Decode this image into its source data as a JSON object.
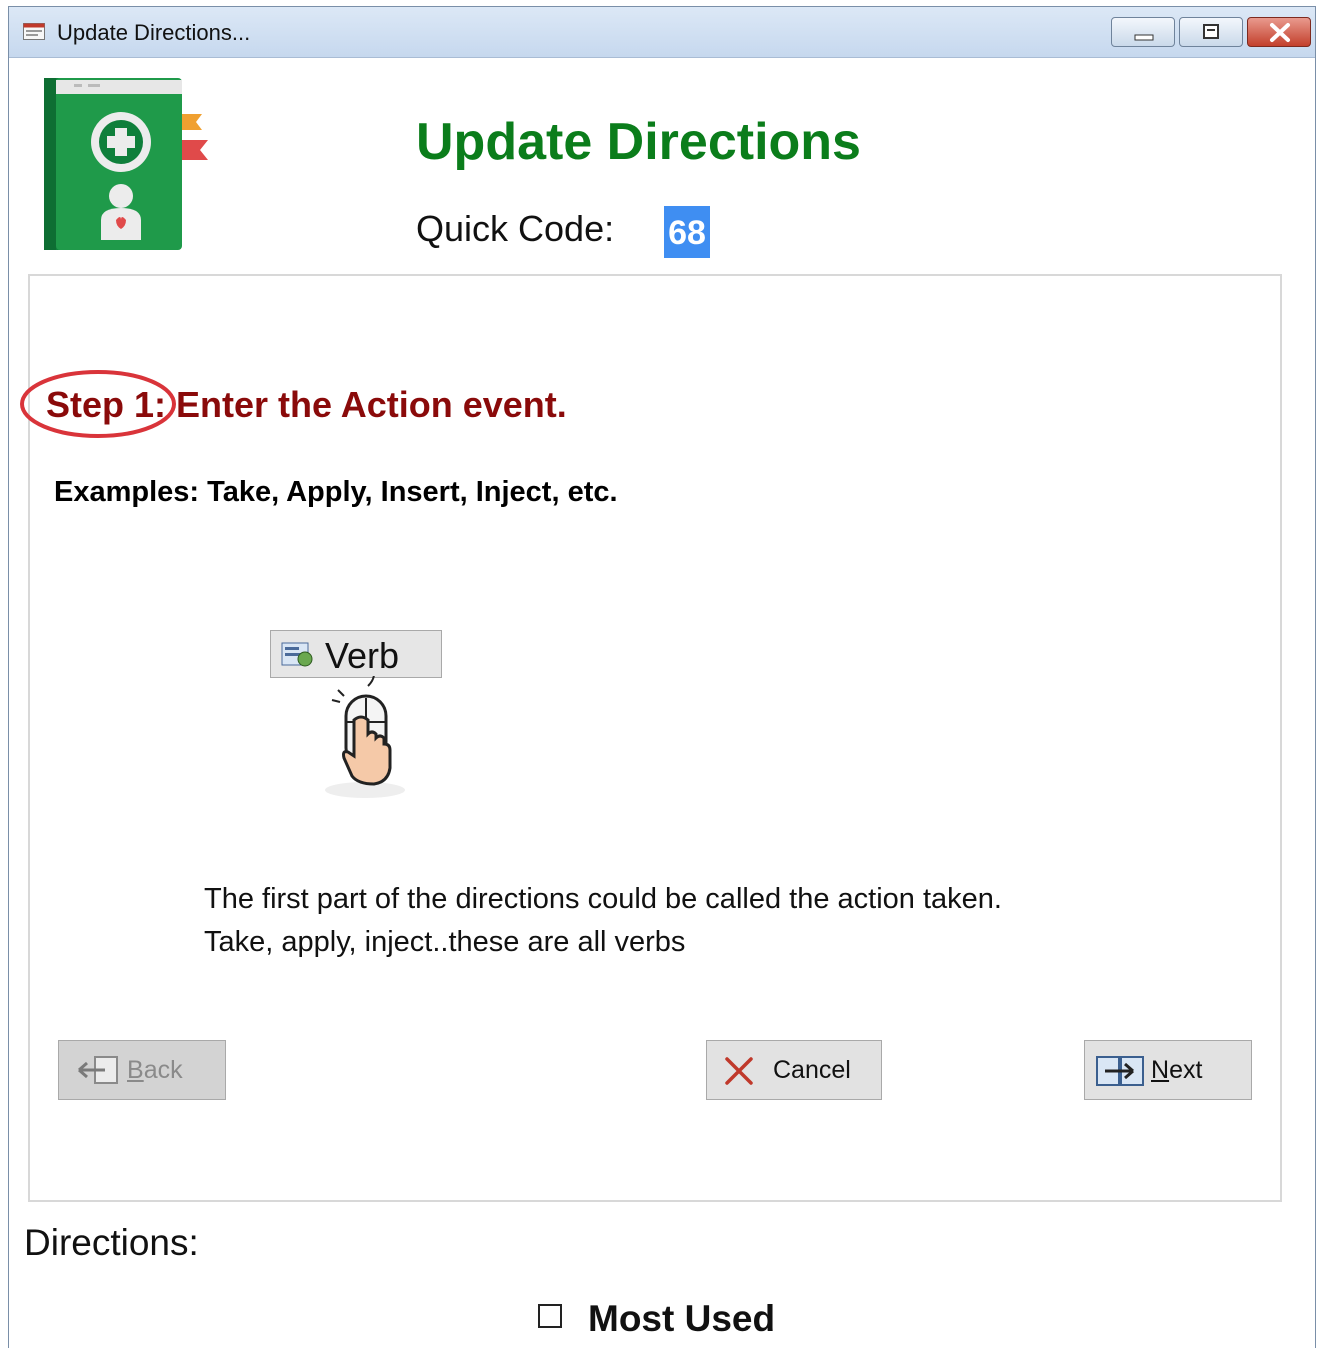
{
  "window": {
    "title": "Update Directions...",
    "controls": [
      "minimize-icon",
      "maximize-icon",
      "close-icon"
    ]
  },
  "header": {
    "title": "Update Directions",
    "quick_code_label": "Quick Code:",
    "quick_code_value": "68"
  },
  "step": {
    "title": "Step 1: Enter the Action event.",
    "examples": "Examples: Take, Apply, Insert, Inject, etc.",
    "verb_button_label": "Verb",
    "description_line1": "The first part of the directions could be called the action taken.",
    "description_line2": "Take, apply, inject..these are all verbs"
  },
  "nav": {
    "back_prefix": "",
    "back_accel": "B",
    "back_rest": "ack",
    "cancel_label": "Cancel",
    "next_accel": "N",
    "next_rest": "ext"
  },
  "footer": {
    "directions_label": "Directions:",
    "most_used_label": "Most Used",
    "most_used_checked": false
  },
  "colors": {
    "title_green": "#0b7d1b",
    "step_red": "#8a0a0a",
    "highlight_blue": "#3f8ef2",
    "circle_red": "#d9343a"
  }
}
